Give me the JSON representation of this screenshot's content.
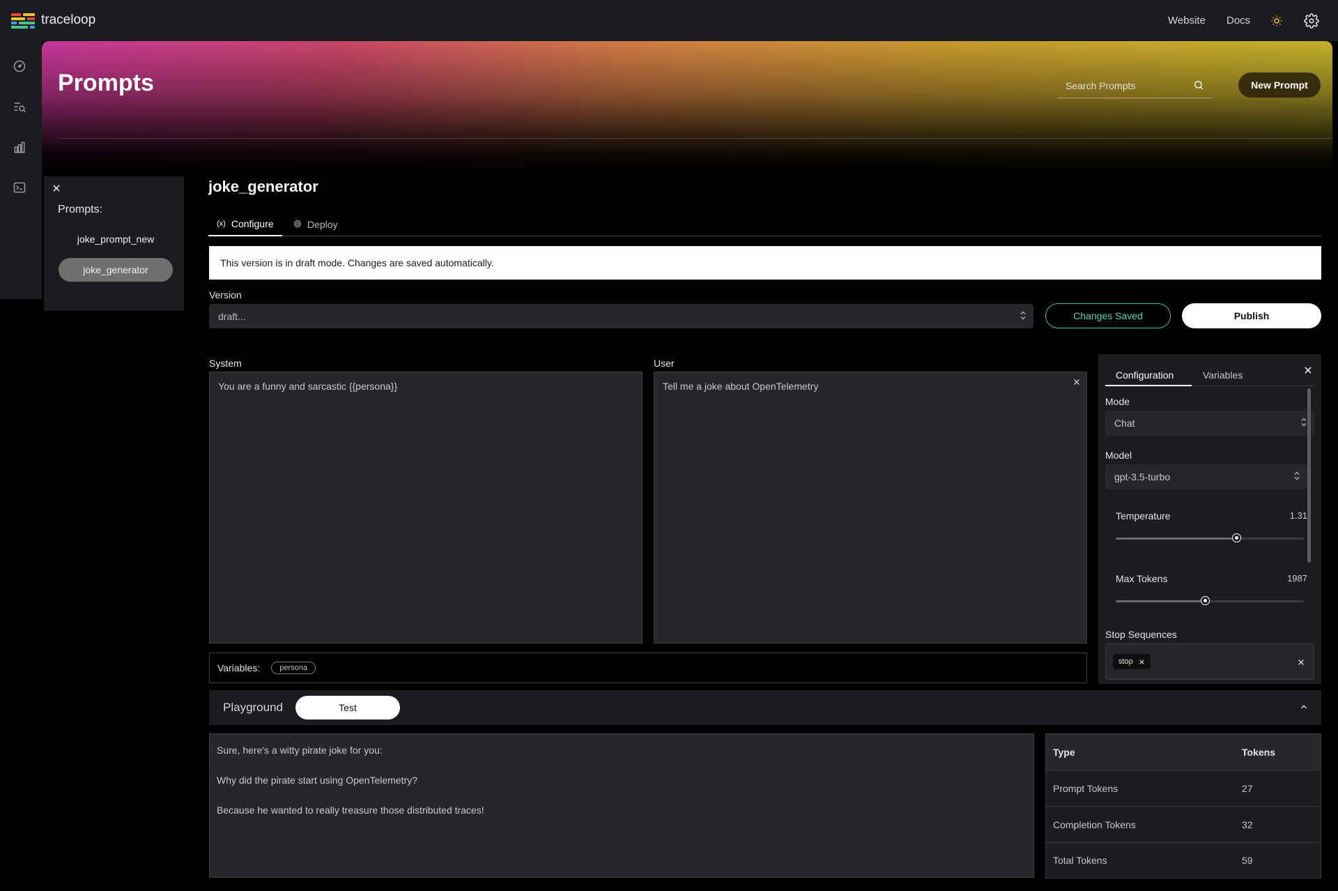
{
  "app": {
    "brand": "traceloop",
    "nav_links": {
      "website": "Website",
      "docs": "Docs"
    },
    "rail_icons": [
      "dashboard-icon",
      "trace-search-icon",
      "metrics-chart-icon",
      "terminal-icon"
    ],
    "logo_colors": [
      "#e8483f",
      "#f0c330",
      "#3fa0e8",
      "#4cc08a"
    ]
  },
  "hero": {
    "title": "Prompts",
    "search_placeholder": "Search Prompts",
    "new_prompt_label": "New Prompt"
  },
  "sidebar": {
    "title": "Prompts:",
    "items": [
      {
        "label": "joke_prompt_new",
        "active": false
      },
      {
        "label": "joke_generator",
        "active": true
      }
    ]
  },
  "main": {
    "title": "joke_generator",
    "tabs": [
      {
        "label": "Configure",
        "active": true
      },
      {
        "label": "Deploy",
        "active": false
      }
    ],
    "banner": "This version is in draft mode. Changes are saved automatically.",
    "version": {
      "label": "Version",
      "value": "draft..."
    },
    "changes_saved_label": "Changes Saved",
    "publish_label": "Publish",
    "system": {
      "label": "System",
      "value": "You are a funny and sarcastic {{persona}}"
    },
    "user": {
      "label": "User",
      "value": "Tell me a joke about OpenTelemetry"
    },
    "variables": {
      "label": "Variables:",
      "chips": [
        "persona"
      ]
    }
  },
  "config": {
    "tabs": [
      {
        "label": "Configuration",
        "active": true
      },
      {
        "label": "Variables",
        "active": false
      }
    ],
    "mode": {
      "label": "Mode",
      "value": "Chat"
    },
    "model": {
      "label": "Model",
      "value": "gpt-3.5-turbo"
    },
    "temperature": {
      "label": "Temperature",
      "value": "1.31",
      "fraction": 0.65
    },
    "max_tokens": {
      "label": "Max Tokens",
      "value": "1987",
      "fraction": 0.485
    },
    "stop_sequences": {
      "label": "Stop Sequences",
      "chips": [
        "stop"
      ]
    }
  },
  "playground": {
    "label": "Playground",
    "test_label": "Test",
    "output": [
      "Sure, here's a witty pirate joke for you:",
      "Why did the pirate start using OpenTelemetry?",
      "Because he wanted to really treasure those distributed traces!"
    ],
    "tokens": {
      "headers": [
        "Type",
        "Tokens"
      ],
      "rows": [
        [
          "Prompt Tokens",
          "27"
        ],
        [
          "Completion Tokens",
          "32"
        ],
        [
          "Total Tokens",
          "59"
        ]
      ]
    }
  },
  "colors": {
    "accent_green": "#5bd3ad",
    "panel": "#1b1c1f",
    "input": "#26272b"
  }
}
